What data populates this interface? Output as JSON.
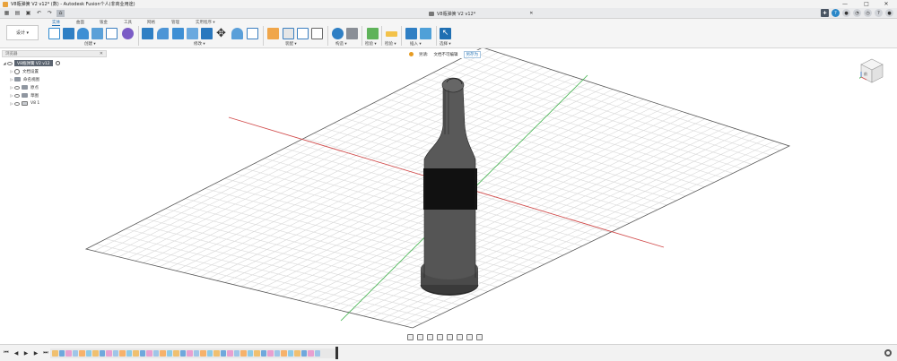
{
  "titlebar": {
    "title": "V8瓶弹簧 V2 v12* (数) - Autodesk Fusion个人(非商业用途)",
    "minimize": "—",
    "maximize": "□",
    "close": "✕"
  },
  "document_tab": {
    "label": "V8瓶弹簧 V2 v12*"
  },
  "ribbon": {
    "workspace_label": "设计 ▾",
    "tabs": [
      "实体",
      "曲面",
      "钣金",
      "工具",
      "网格",
      "管理",
      "实用程序 ▾"
    ],
    "groups": {
      "create": "创建 ▾",
      "modify": "修改 ▾",
      "assemble": "装配 ▾",
      "construct": "构造 ▾",
      "inspect": "检验 ▾",
      "insert": "插入 ▾",
      "select": "选择 ▾"
    }
  },
  "browser": {
    "header": "浏览器",
    "root": "V8瓶弹簧 V2 v12",
    "items": [
      "文档设置",
      "命名视图",
      "原点",
      "草图",
      "V8 1"
    ]
  },
  "notification": {
    "message": "另请:",
    "info": "文档不可编辑",
    "link": "另存为"
  },
  "viewcube": {
    "face_label": "前"
  },
  "colors": {
    "accent": "#1f6fb2",
    "grid": "#d9d9d9",
    "x_axis": "#d14b4b",
    "y_axis": "#3fb24a",
    "body": "#555555",
    "body_band": "#111111"
  },
  "icons": [
    "grid-menu-icon",
    "file-icon",
    "save-icon",
    "undo-icon",
    "redo-icon",
    "home-icon",
    "close-icon",
    "add-icon",
    "help-icon",
    "notification-icon",
    "user-icon"
  ]
}
